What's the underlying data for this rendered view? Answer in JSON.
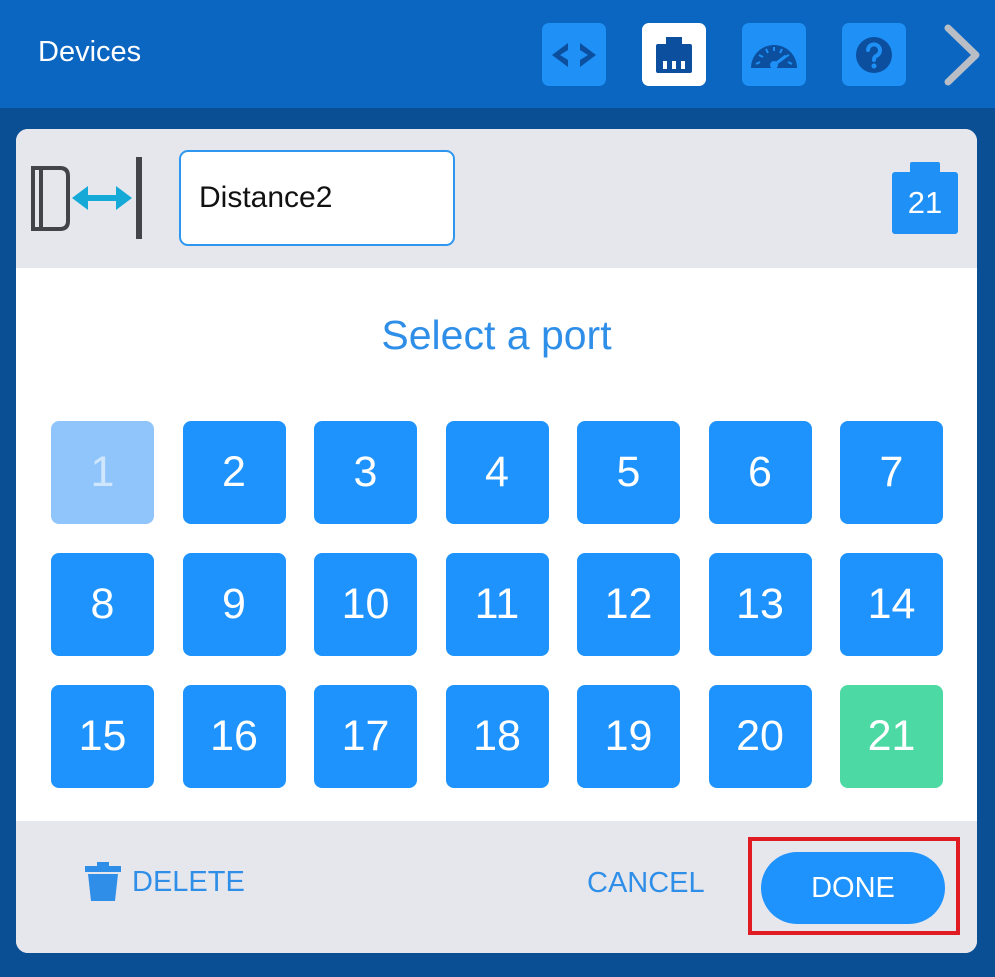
{
  "header": {
    "title": "Devices",
    "toolbar": [
      {
        "icon": "code-icon",
        "active": false
      },
      {
        "icon": "devices-port-icon",
        "active": true
      },
      {
        "icon": "dashboard-gauge-icon",
        "active": false
      },
      {
        "icon": "help-icon",
        "active": false
      }
    ],
    "next_icon": "chevron-right-icon"
  },
  "dialog": {
    "device_icon": "distance-sensor-icon",
    "device_name": "Distance2",
    "current_port": "21",
    "select_title": "Select a port",
    "ports": [
      {
        "label": "1",
        "state": "disabled"
      },
      {
        "label": "2",
        "state": "available"
      },
      {
        "label": "3",
        "state": "available"
      },
      {
        "label": "4",
        "state": "available"
      },
      {
        "label": "5",
        "state": "available"
      },
      {
        "label": "6",
        "state": "available"
      },
      {
        "label": "7",
        "state": "available"
      },
      {
        "label": "8",
        "state": "available"
      },
      {
        "label": "9",
        "state": "available"
      },
      {
        "label": "10",
        "state": "available"
      },
      {
        "label": "11",
        "state": "available"
      },
      {
        "label": "12",
        "state": "available"
      },
      {
        "label": "13",
        "state": "available"
      },
      {
        "label": "14",
        "state": "available"
      },
      {
        "label": "15",
        "state": "available"
      },
      {
        "label": "16",
        "state": "available"
      },
      {
        "label": "17",
        "state": "available"
      },
      {
        "label": "18",
        "state": "available"
      },
      {
        "label": "19",
        "state": "available"
      },
      {
        "label": "20",
        "state": "available"
      },
      {
        "label": "21",
        "state": "selected"
      }
    ],
    "footer": {
      "delete_label": "DELETE",
      "cancel_label": "CANCEL",
      "done_label": "DONE"
    }
  },
  "colors": {
    "header_bg": "#0b66c2",
    "accent": "#1e93fd",
    "selected": "#4cd9a4",
    "disabled": "#90c5fb",
    "highlight": "#e11b22"
  }
}
